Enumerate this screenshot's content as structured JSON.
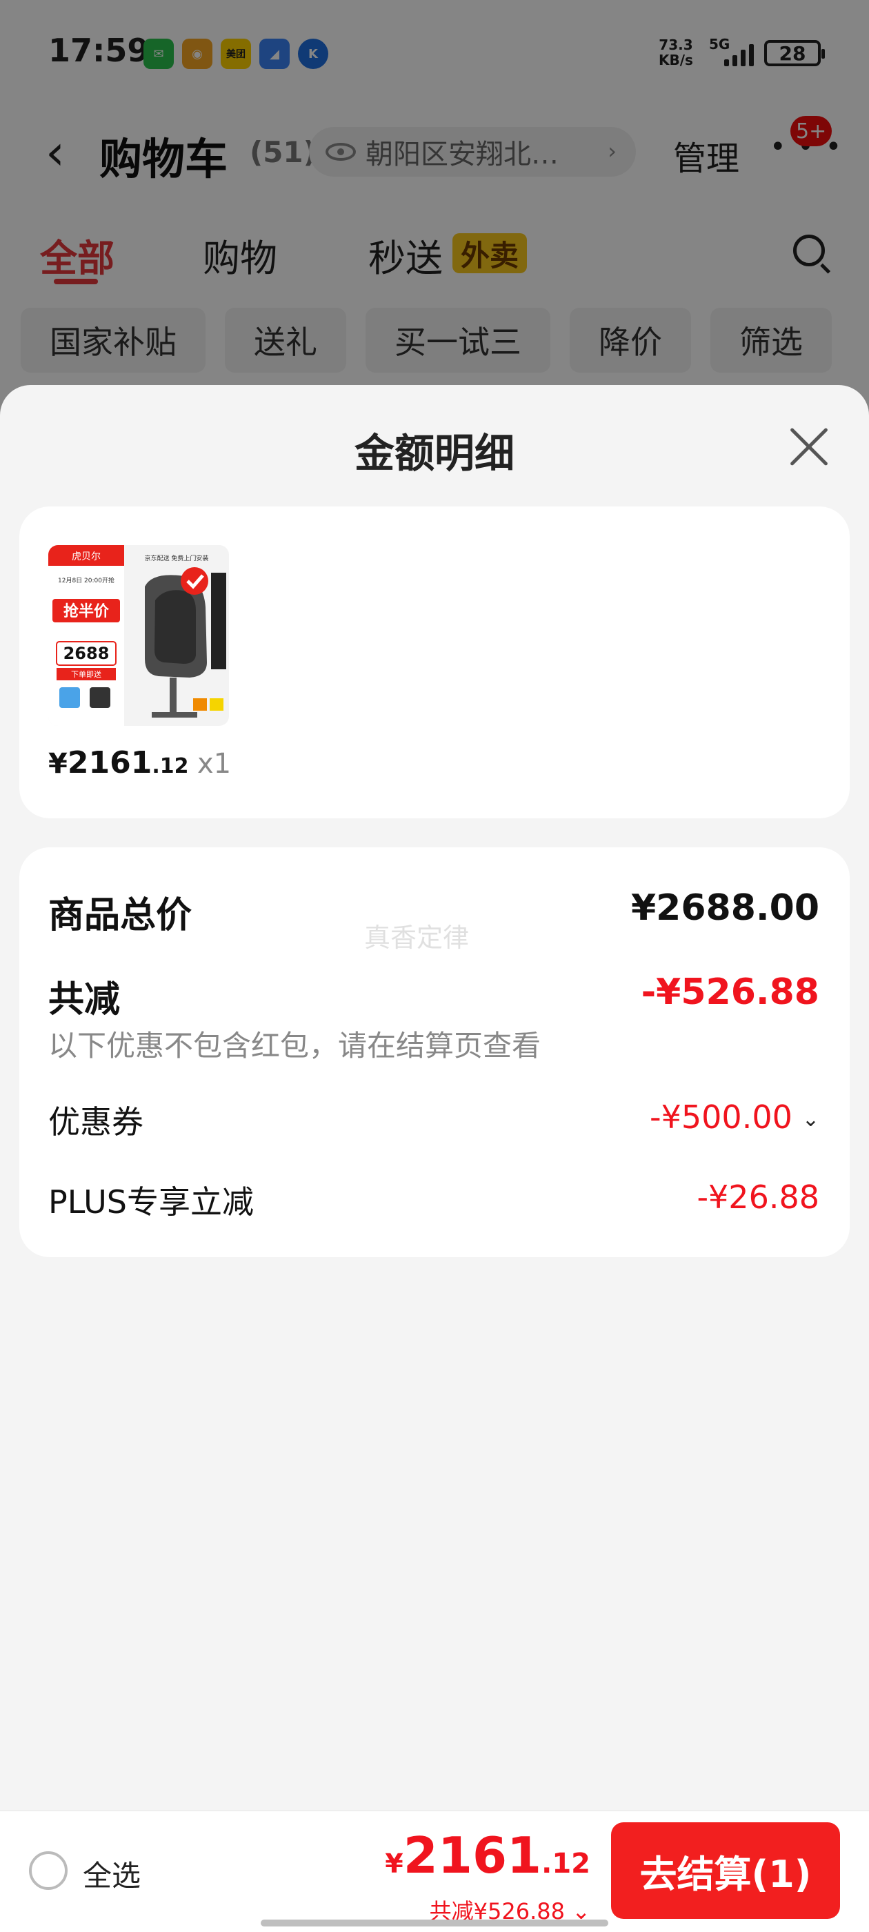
{
  "status_bar": {
    "time": "17:59",
    "apps": [
      {
        "name": "wechat-icon",
        "color": "#2bc14d",
        "glyph": "✉"
      },
      {
        "name": "weibo-icon",
        "color": "#f5a623",
        "glyph": "◉"
      },
      {
        "name": "meituan-icon",
        "color": "#ffd100",
        "glyph": "美团"
      },
      {
        "name": "feishu-icon",
        "color": "#3b82f6",
        "glyph": "◢"
      },
      {
        "name": "k-app-icon",
        "color": "#1f6fe0",
        "glyph": "K"
      }
    ],
    "net_speed": "73.3",
    "net_unit": "KB/s",
    "network": "5G",
    "battery": "28"
  },
  "header": {
    "title": "购物车",
    "count": "(51)",
    "address": "朝阳区安翔北…",
    "manage": "管理",
    "more_glyph": "• • •",
    "badge": "5+"
  },
  "tabs": {
    "all": "全部",
    "shopping": "购物",
    "quick": "秒送",
    "quick_badge": "外卖"
  },
  "chips": [
    "国家补贴",
    "送礼",
    "买一试三",
    "降价",
    "筛选"
  ],
  "sheet": {
    "title": "金额明细",
    "product": {
      "price_symbol": "¥",
      "price_int": "2161",
      "price_dec": ".12",
      "qty": "x1",
      "image_texts": {
        "brand": "虎贝尔",
        "promo": "抢半价",
        "price": "2688",
        "tag": "下单即送",
        "date": "12月8日 20:00开抢",
        "ship": "京东配送 免费上门安装"
      }
    },
    "summary": {
      "total_label": "商品总价",
      "total_value": "¥2688.00",
      "watermark": "真香定律",
      "discount_label": "共减",
      "discount_value": "-¥526.88",
      "note": "以下优惠不包含红包，请在结算页查看",
      "coupon_label": "优惠券",
      "coupon_value": "-¥500.00",
      "plus_label": "PLUS专享立减",
      "plus_value": "-¥26.88"
    }
  },
  "bottom_bar": {
    "select_all": "全选",
    "total_symbol": "¥",
    "total_int": "2161",
    "total_dec": ".12",
    "total_discount": "共减¥526.88",
    "discount_chevron": "⌄",
    "checkout": "去结算(1)"
  },
  "colors": {
    "accent_red": "#f0141e",
    "tab_red": "#e4393c",
    "checkout_red": "#f21f1f"
  }
}
